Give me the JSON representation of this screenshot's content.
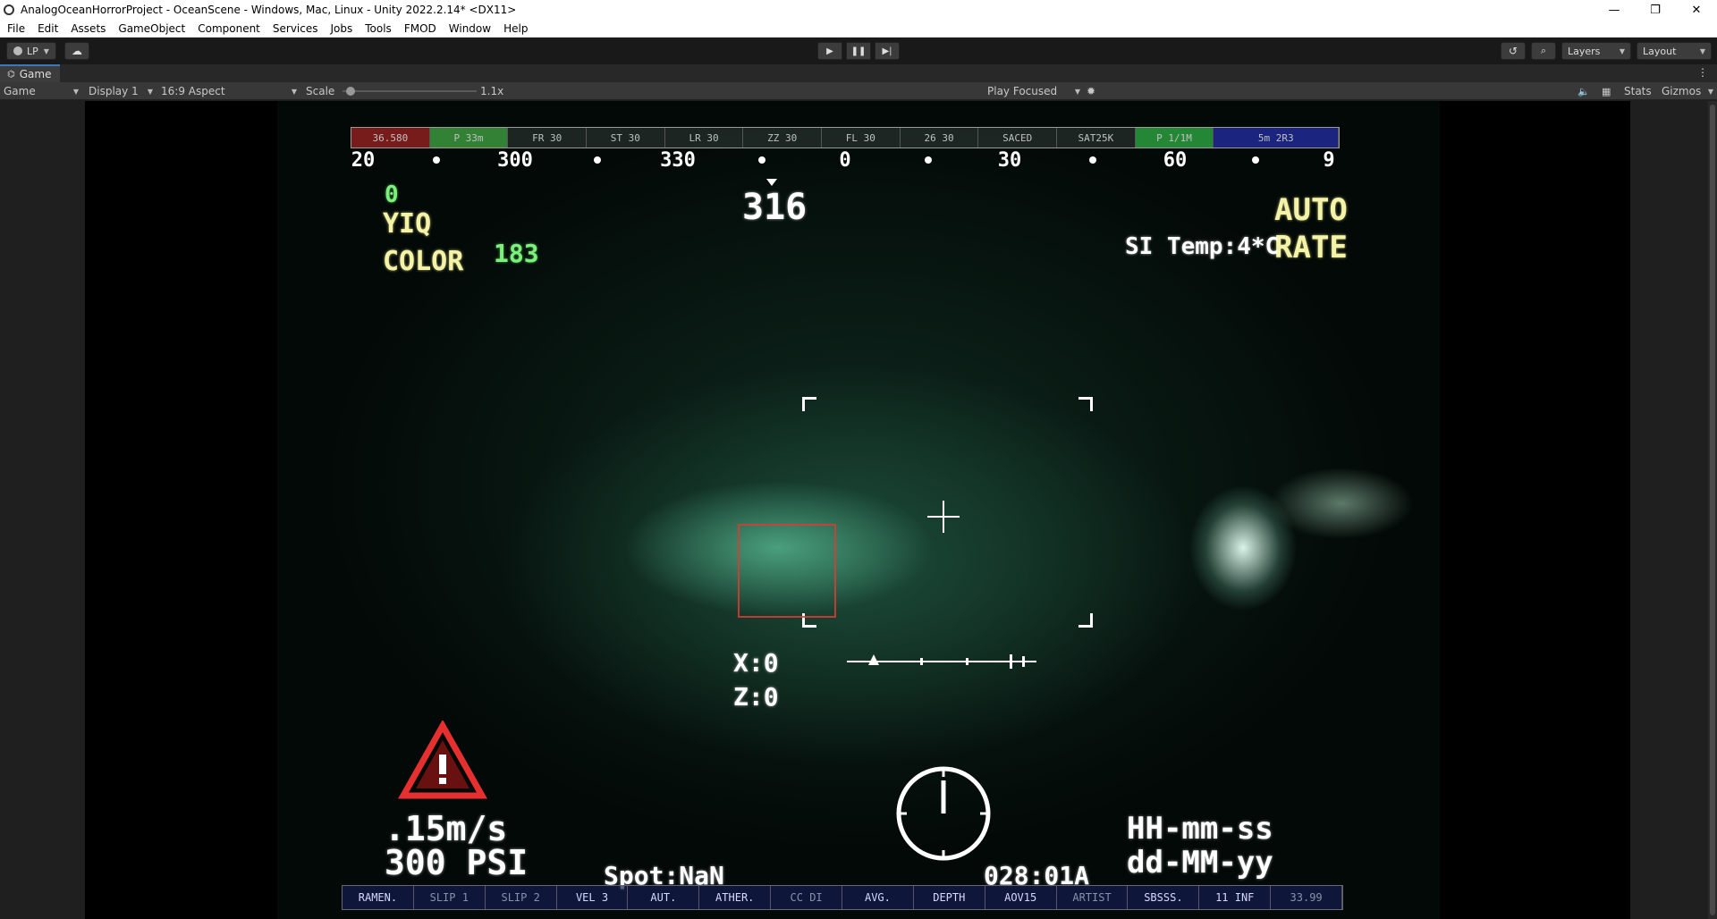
{
  "window": {
    "title": "AnalogOceanHorrorProject - OceanScene - Windows, Mac, Linux - Unity 2022.2.14* <DX11>",
    "minimize": "—",
    "restore": "❐",
    "close": "✕"
  },
  "menu": [
    "File",
    "Edit",
    "Assets",
    "GameObject",
    "Component",
    "Services",
    "Jobs",
    "Tools",
    "FMOD",
    "Window",
    "Help"
  ],
  "toolbar": {
    "account": "LP",
    "layers": "Layers",
    "layout": "Layout"
  },
  "tab": {
    "label": "Game"
  },
  "options": {
    "mode": "Game",
    "display": "Display 1",
    "aspect": "16:9 Aspect",
    "scale_label": "Scale",
    "scale_value": "1.1x",
    "play_mode": "Play Focused",
    "stats": "Stats",
    "gizmos": "Gizmos"
  },
  "hud": {
    "top_segments": [
      "36.580",
      "P 33m",
      "FR 30",
      "ST 30",
      "LR 30",
      "ZZ 30",
      "FL 30",
      "26 30",
      "SACED",
      "SAT25K",
      "P 1/1M",
      "5m 2R3"
    ],
    "compass": [
      "20",
      "300",
      "330",
      "0",
      "30",
      "60",
      "9"
    ],
    "heading": "316",
    "mode_indicator": "0",
    "video_standard": "YIQ",
    "color_label": "COLOR",
    "color_value": "183",
    "auto_label": "AUTO",
    "rate_label": "RATE",
    "temperature": "SI Temp:4*C",
    "x_coord": "X:0",
    "z_coord": "Z:0",
    "speed": ".15m/s",
    "pressure": "300 PSI",
    "spot": "Spot:NaN",
    "code": "028:01A",
    "time_format": "HH-mm-ss",
    "date_format": "dd-MM-yy",
    "bottom_segments": [
      "RAMEN.",
      "SLIP 1",
      "SLIP 2",
      "VEL 3",
      "AUT.",
      "ATHER.",
      "CC DI",
      "AVG.",
      "DEPTH",
      "AOV15",
      "ARTIST",
      "SBSSS.",
      "11 INF",
      "33.99"
    ]
  }
}
